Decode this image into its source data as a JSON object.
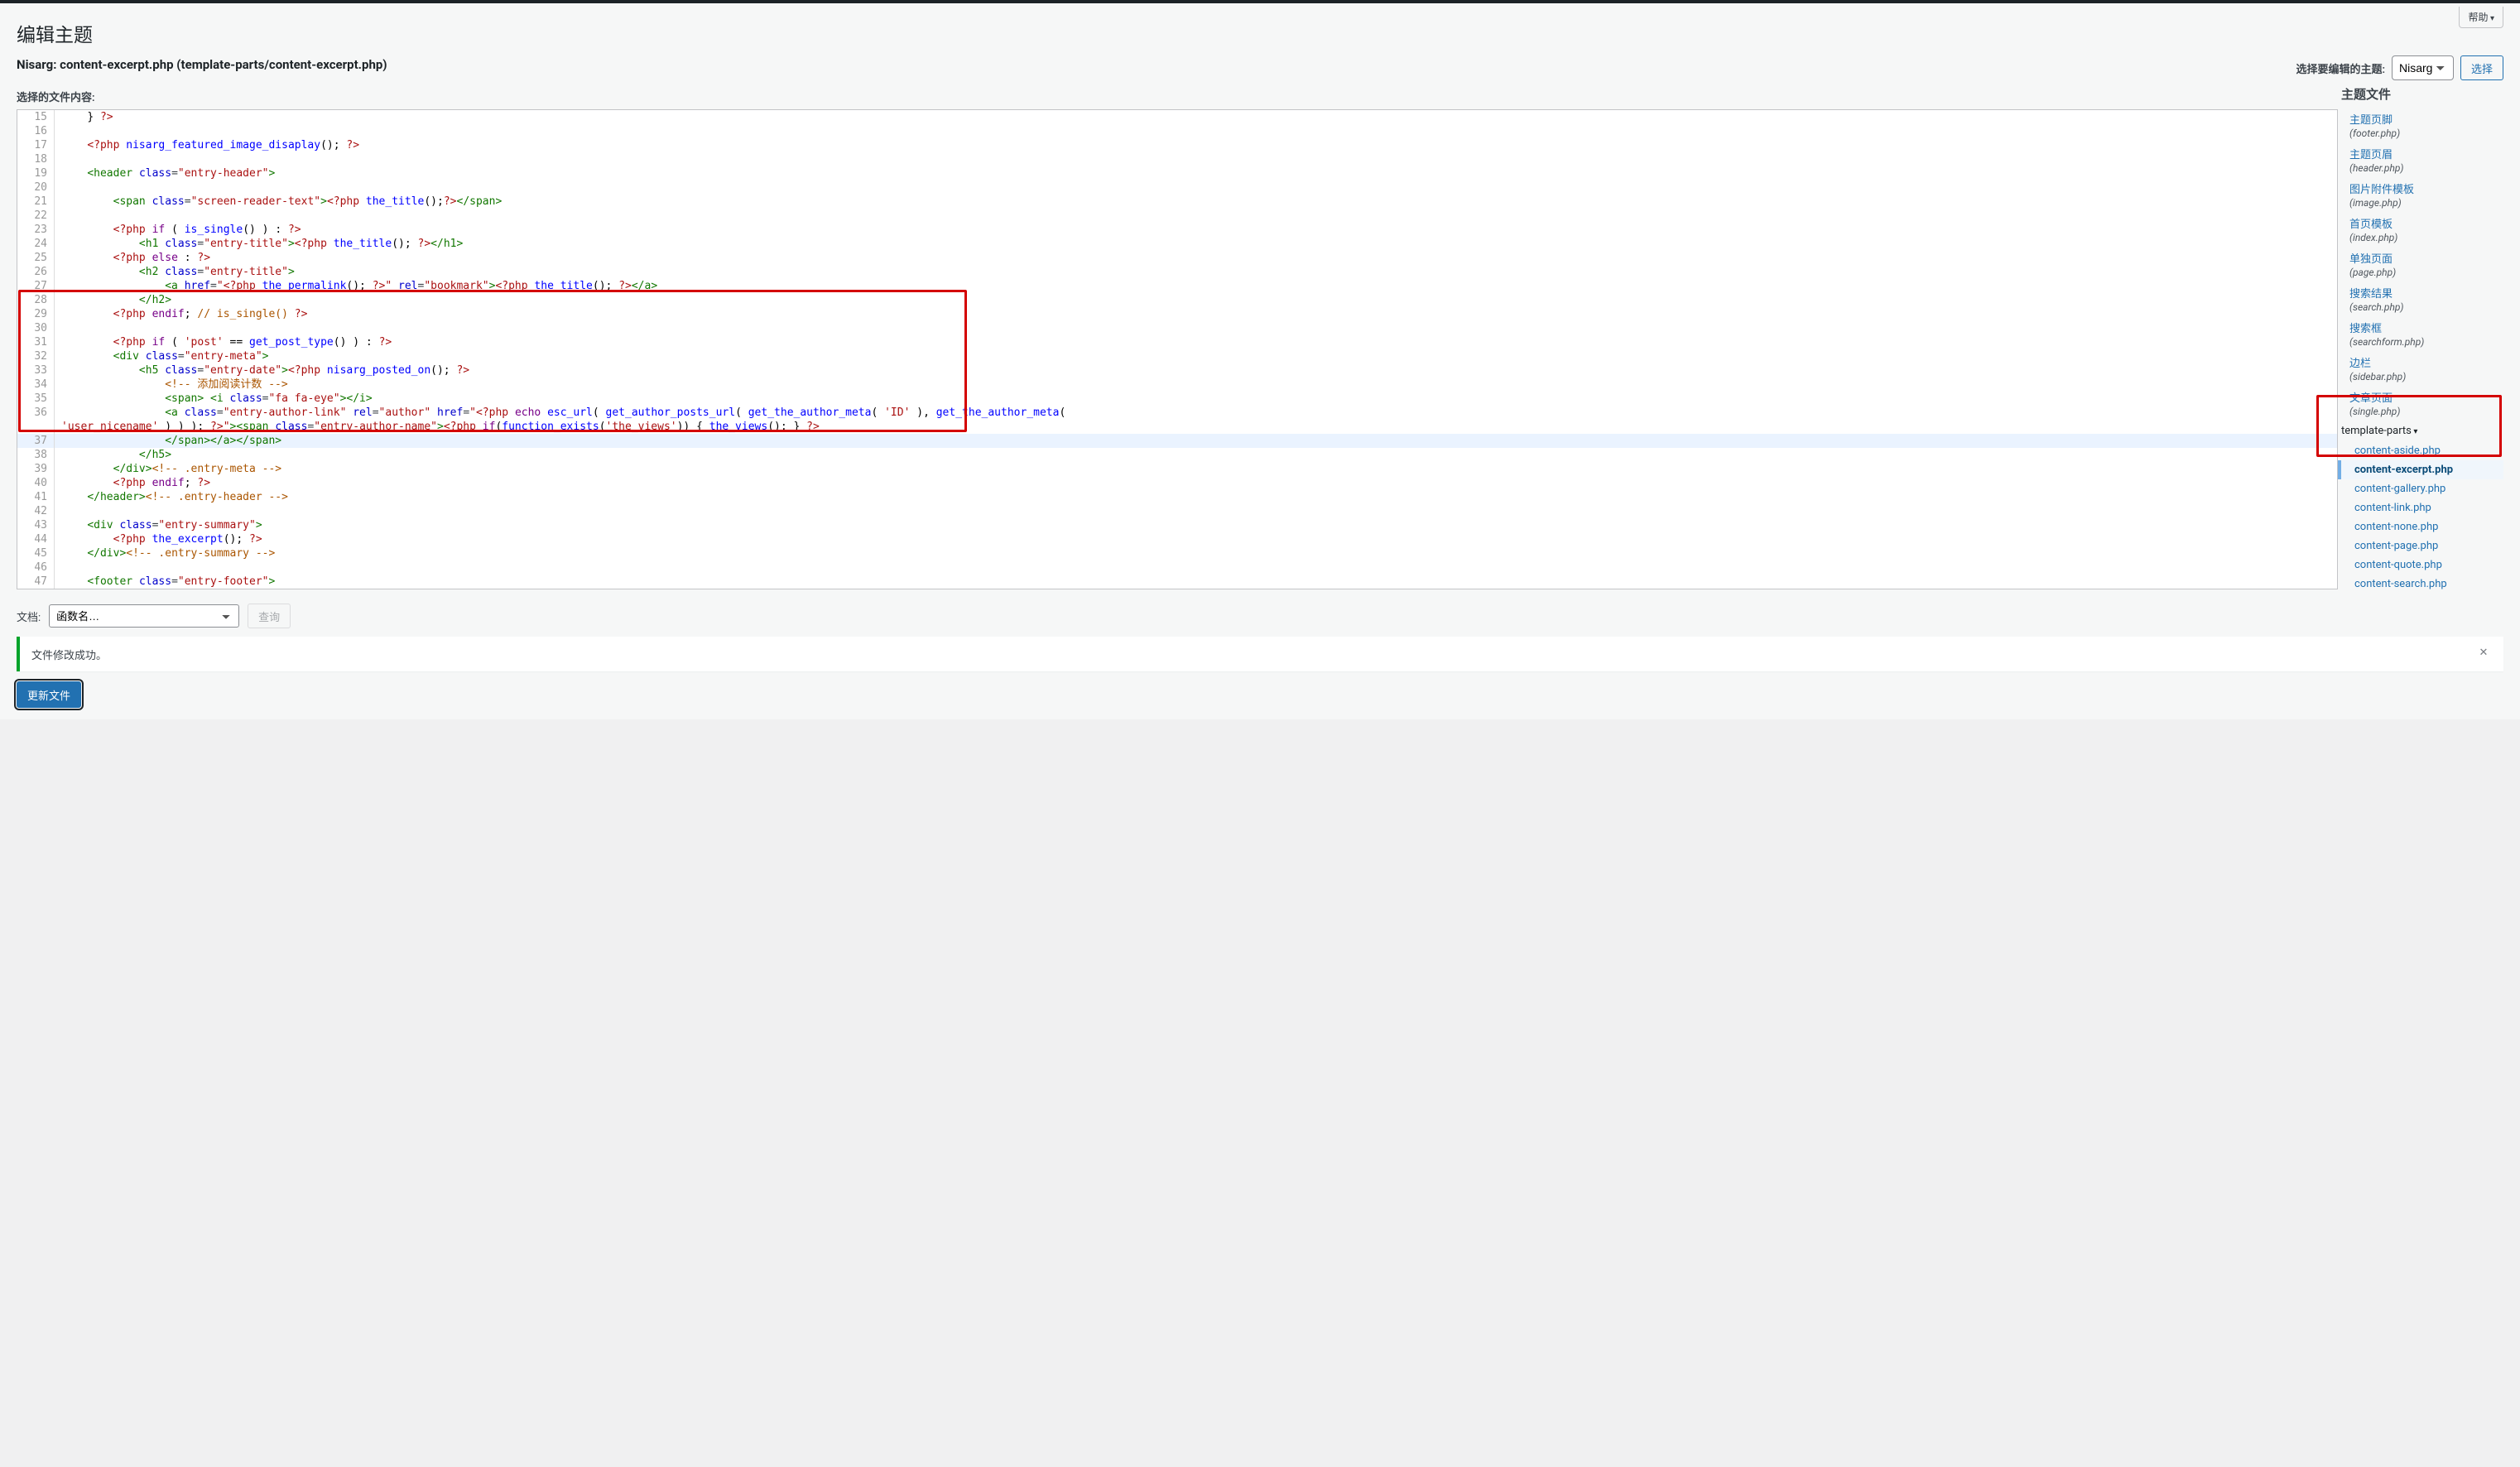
{
  "help_label": "帮助",
  "page_title": "编辑主题",
  "file_heading": "Nisarg: content-excerpt.php (template-parts/content-excerpt.php)",
  "theme_select_label": "选择要编辑的主题:",
  "theme_select_value": "Nisarg",
  "select_button": "选择",
  "selected_file_label": "选择的文件内容:",
  "theme_files_header": "主题文件",
  "code_lines": [
    {
      "n": 15,
      "html": "    <span class='t-plain'>} </span><span class='t-phpdelim'>?&gt;</span>"
    },
    {
      "n": 16,
      "html": ""
    },
    {
      "n": 17,
      "html": "    <span class='t-phpdelim'>&lt;?php</span> <span class='t-fn'>nisarg_featured_image_disaplay</span><span class='t-plain'>(); </span><span class='t-phpdelim'>?&gt;</span>"
    },
    {
      "n": 18,
      "html": ""
    },
    {
      "n": 19,
      "html": "    <span class='t-tag'>&lt;header</span> <span class='t-attr'>class</span>=<span class='t-str'>\"entry-header\"</span><span class='t-tag'>&gt;</span>"
    },
    {
      "n": 20,
      "html": ""
    },
    {
      "n": 21,
      "html": "        <span class='t-tag'>&lt;span</span> <span class='t-attr'>class</span>=<span class='t-str'>\"screen-reader-text\"</span><span class='t-tag'>&gt;</span><span class='t-phpdelim'>&lt;?php</span> <span class='t-fn'>the_title</span><span class='t-plain'>();</span><span class='t-phpdelim'>?&gt;</span><span class='t-tag'>&lt;/span&gt;</span>"
    },
    {
      "n": 22,
      "html": ""
    },
    {
      "n": 23,
      "html": "        <span class='t-phpdelim'>&lt;?php</span> <span class='t-kw'>if</span> <span class='t-plain'>( </span><span class='t-fn'>is_single</span><span class='t-plain'>() ) : </span><span class='t-phpdelim'>?&gt;</span>"
    },
    {
      "n": 24,
      "html": "            <span class='t-tag'>&lt;h1</span> <span class='t-attr'>class</span>=<span class='t-str'>\"entry-title\"</span><span class='t-tag'>&gt;</span><span class='t-phpdelim'>&lt;?php</span> <span class='t-fn'>the_title</span><span class='t-plain'>(); </span><span class='t-phpdelim'>?&gt;</span><span class='t-tag'>&lt;/h1&gt;</span>"
    },
    {
      "n": 25,
      "html": "        <span class='t-phpdelim'>&lt;?php</span> <span class='t-kw'>else</span> <span class='t-plain'>: </span><span class='t-phpdelim'>?&gt;</span>"
    },
    {
      "n": 26,
      "html": "            <span class='t-tag'>&lt;h2</span> <span class='t-attr'>class</span>=<span class='t-str'>\"entry-title\"</span><span class='t-tag'>&gt;</span>"
    },
    {
      "n": 27,
      "html": "                <span class='t-tag'>&lt;a</span> <span class='t-attr'>href</span>=<span class='t-str'>\"</span><span class='t-phpdelim'>&lt;?php</span> <span class='t-fn'>the_permalink</span><span class='t-plain'>(); </span><span class='t-phpdelim'>?&gt;</span><span class='t-str'>\"</span> <span class='t-attr'>rel</span>=<span class='t-str'>\"bookmark\"</span><span class='t-tag'>&gt;</span><span class='t-phpdelim'>&lt;?php</span> <span class='t-fn'>the_title</span><span class='t-plain'>(); </span><span class='t-phpdelim'>?&gt;</span><span class='t-tag'>&lt;/a&gt;</span>"
    },
    {
      "n": 28,
      "html": "            <span class='t-tag'>&lt;/h2&gt;</span>"
    },
    {
      "n": 29,
      "html": "        <span class='t-phpdelim'>&lt;?php</span> <span class='t-kw'>endif</span><span class='t-plain'>; </span><span class='t-cmnt'>// is_single() </span><span class='t-phpdelim'>?&gt;</span>"
    },
    {
      "n": 30,
      "html": ""
    },
    {
      "n": 31,
      "html": "        <span class='t-phpdelim'>&lt;?php</span> <span class='t-kw'>if</span> <span class='t-plain'>( </span><span class='t-str'>'post'</span> <span class='t-plain'>== </span><span class='t-fn'>get_post_type</span><span class='t-plain'>() ) : </span><span class='t-phpdelim'>?&gt;</span>"
    },
    {
      "n": 32,
      "html": "        <span class='t-tag'>&lt;div</span> <span class='t-attr'>class</span>=<span class='t-str'>\"entry-meta\"</span><span class='t-tag'>&gt;</span>"
    },
    {
      "n": 33,
      "html": "            <span class='t-tag'>&lt;h5</span> <span class='t-attr'>class</span>=<span class='t-str'>\"entry-date\"</span><span class='t-tag'>&gt;</span><span class='t-phpdelim'>&lt;?php</span> <span class='t-fn'>nisarg_posted_on</span><span class='t-plain'>(); </span><span class='t-phpdelim'>?&gt;</span>"
    },
    {
      "n": 34,
      "html": "                <span class='t-htmlc'>&lt;!-- 添加阅读计数 --&gt;</span>"
    },
    {
      "n": 35,
      "html": "                <span class='t-tag'>&lt;span&gt;</span> <span class='t-tag'>&lt;i</span> <span class='t-attr'>class</span>=<span class='t-str'>\"fa fa-eye\"</span><span class='t-tag'>&gt;&lt;/i&gt;</span>"
    },
    {
      "n": 36,
      "html": "                <span class='t-tag'>&lt;a</span> <span class='t-attr'>class</span>=<span class='t-str'>\"entry-author-link\"</span> <span class='t-attr'>rel</span>=<span class='t-str'>\"author\"</span> <span class='t-attr'>href</span>=<span class='t-str'>\"</span><span class='t-phpdelim'>&lt;?php</span> <span class='t-kw'>echo</span> <span class='t-fn'>esc_url</span><span class='t-plain'>( </span><span class='t-fn'>get_author_posts_url</span><span class='t-plain'>( </span><span class='t-fn'>get_the_author_meta</span><span class='t-plain'>( </span><span class='t-str'>'ID'</span><span class='t-plain'> ), </span><span class='t-fn'>get_the_author_meta</span><span class='t-plain'>( </span>",
      "wrap": "<span class='t-str'>'user_nicename'</span><span class='t-plain'> ) ) ); </span><span class='t-phpdelim'>?&gt;</span><span class='t-str'>\"</span><span class='t-tag'>&gt;</span><span class='t-tag'>&lt;span</span> <span class='t-attr'>class</span>=<span class='t-str'>\"entry-author-name\"</span><span class='t-tag'>&gt;</span><span class='t-phpdelim'>&lt;?php</span> <span class='t-kw'>if</span><span class='t-plain'>(</span><span class='t-fn'>function_exists</span><span class='t-plain'>(</span><span class='t-str'>'the_views'</span><span class='t-plain'>)) { </span><span class='t-fn'>the_views</span><span class='t-plain'>(); } </span><span class='t-phpdelim'>?&gt;</span>"
    },
    {
      "n": 37,
      "active": true,
      "html": "                <span class='t-tag'>&lt;/span&gt;&lt;/a&gt;&lt;/span&gt;</span>"
    },
    {
      "n": 38,
      "html": "            <span class='t-tag'>&lt;/h5&gt;</span>"
    },
    {
      "n": 39,
      "html": "        <span class='t-tag'>&lt;/div&gt;</span><span class='t-htmlc'>&lt;!-- .entry-meta --&gt;</span>"
    },
    {
      "n": 40,
      "html": "        <span class='t-phpdelim'>&lt;?php</span> <span class='t-kw'>endif</span><span class='t-plain'>; </span><span class='t-phpdelim'>?&gt;</span>"
    },
    {
      "n": 41,
      "html": "    <span class='t-tag'>&lt;/header&gt;</span><span class='t-htmlc'>&lt;!-- .entry-header --&gt;</span>"
    },
    {
      "n": 42,
      "html": ""
    },
    {
      "n": 43,
      "html": "    <span class='t-tag'>&lt;div</span> <span class='t-attr'>class</span>=<span class='t-str'>\"entry-summary\"</span><span class='t-tag'>&gt;</span>"
    },
    {
      "n": 44,
      "html": "        <span class='t-phpdelim'>&lt;?php</span> <span class='t-fn'>the_excerpt</span><span class='t-plain'>(); </span><span class='t-phpdelim'>?&gt;</span>"
    },
    {
      "n": 45,
      "html": "    <span class='t-tag'>&lt;/div&gt;</span><span class='t-htmlc'>&lt;!-- .entry-summary --&gt;</span>"
    },
    {
      "n": 46,
      "html": ""
    },
    {
      "n": 47,
      "html": "    <span class='t-tag'>&lt;footer</span> <span class='t-attr'>class</span>=<span class='t-str'>\"entry-footer\"</span><span class='t-tag'>&gt;</span>"
    }
  ],
  "sidebar_files": [
    {
      "name": "主题页脚",
      "fname": "(footer.php)"
    },
    {
      "name": "主题页眉",
      "fname": "(header.php)"
    },
    {
      "name": "图片附件模板",
      "fname": "(image.php)"
    },
    {
      "name": "首页模板",
      "fname": "(index.php)"
    },
    {
      "name": "单独页面",
      "fname": "(page.php)"
    },
    {
      "name": "搜索结果",
      "fname": "(search.php)"
    },
    {
      "name": "搜索框",
      "fname": "(searchform.php)"
    },
    {
      "name": "边栏",
      "fname": "(sidebar.php)"
    },
    {
      "name": "文章页面",
      "fname": "(single.php)"
    }
  ],
  "template_parts_label": "template-parts",
  "template_parts_files": [
    {
      "name": "content-aside.php",
      "active": false
    },
    {
      "name": "content-excerpt.php",
      "active": true
    },
    {
      "name": "content-gallery.php",
      "active": false
    },
    {
      "name": "content-link.php",
      "active": false
    },
    {
      "name": "content-none.php",
      "active": false
    },
    {
      "name": "content-page.php",
      "active": false
    },
    {
      "name": "content-quote.php",
      "active": false
    },
    {
      "name": "content-search.php",
      "active": false
    }
  ],
  "docs_label": "文档:",
  "docs_placeholder": "函数名…",
  "lookup_button": "查询",
  "notice_text": "文件修改成功。",
  "update_button": "更新文件"
}
